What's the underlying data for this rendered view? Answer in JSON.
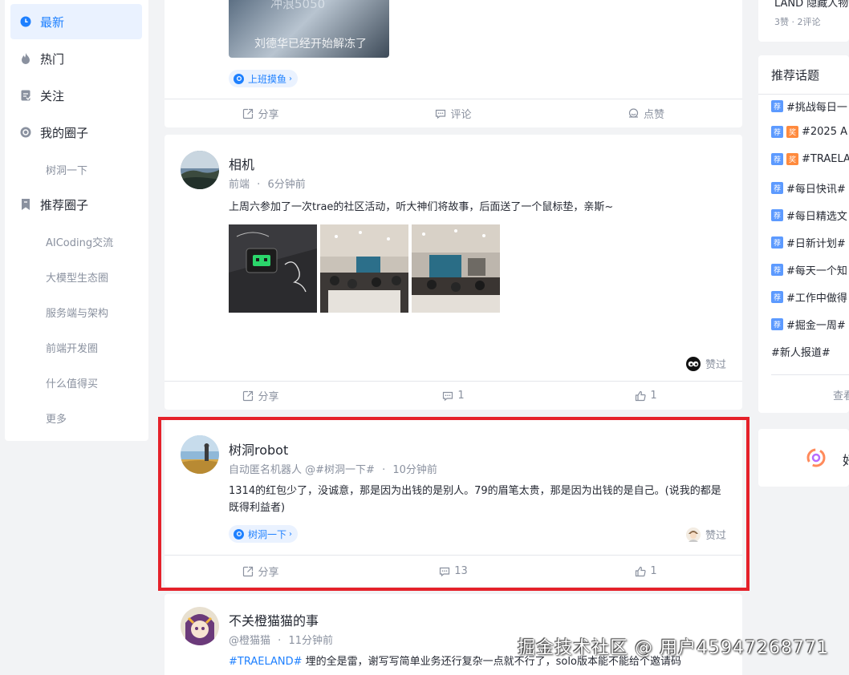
{
  "sidebar": {
    "items": [
      {
        "label": "最新",
        "icon": "clock-icon"
      },
      {
        "label": "热门",
        "icon": "flame-icon"
      },
      {
        "label": "关注",
        "icon": "follow-icon"
      },
      {
        "label": "我的圈子",
        "icon": "circle-icon"
      },
      {
        "label": "树洞一下"
      },
      {
        "label": "推荐圈子",
        "icon": "bookmark-icon"
      },
      {
        "label": "AICoding交流"
      },
      {
        "label": "大模型生态圈"
      },
      {
        "label": "服务端与架构"
      },
      {
        "label": "前端开发圈"
      },
      {
        "label": "什么值得买"
      },
      {
        "label": "更多"
      }
    ],
    "active_color": "#1e80ff"
  },
  "posts": [
    {
      "image_caption": "刘德华已经开始解冻了",
      "image_top_text": "冲浪5050",
      "tag": "上班摸鱼",
      "actions": {
        "share": "分享",
        "comment": "评论",
        "like": "点赞"
      }
    },
    {
      "author": "相机",
      "circle": "前端",
      "separator": "·",
      "time": "6分钟前",
      "text": "上周六参加了一次trae的社区活动，听大神们将故事，后面送了一个鼠标垫，亲斯~",
      "zan": "赞过",
      "actions": {
        "share": "分享",
        "comment": "1",
        "like": "1"
      }
    },
    {
      "author": "树洞robot",
      "meta": "自动匿名机器人 @#树洞一下#",
      "separator": "·",
      "time": "10分钟前",
      "text": "1314的红包少了，没诚意，那是因为出钱的是别人。79的眉笔太贵，那是因为出钱的是自己。(说我的都是既得利益者)",
      "tag": "树洞一下",
      "zan": "赞过",
      "actions": {
        "share": "分享",
        "comment": "13",
        "like": "1"
      }
    },
    {
      "author": "不关橙猫猫的事",
      "meta": "@橙猫猫",
      "separator": "·",
      "time": "11分钟前",
      "hashtag": "#TRAELAND#",
      "text": " 埋的全是雷，谢写写简单业务还行复杂一点就不行了，solo版本能不能给个邀请码"
    }
  ],
  "right": {
    "top_line": "LAND 隐藏人物",
    "top_stats": "3赞 · 2评论",
    "topics_title": "推荐话题",
    "topics": [
      {
        "badges": [
          "荐"
        ],
        "text": "#挑战每日一"
      },
      {
        "badges": [
          "荐",
          "奖"
        ],
        "text": "#2025 A"
      },
      {
        "badges": [
          "荐",
          "奖"
        ],
        "text": "#TRAELA"
      },
      {
        "badges": [
          "荐"
        ],
        "text": "#每日快讯#"
      },
      {
        "badges": [
          "荐"
        ],
        "text": "#每日精选文"
      },
      {
        "badges": [
          "荐"
        ],
        "text": "#日新计划#"
      },
      {
        "badges": [
          "荐"
        ],
        "text": "#每天一个知"
      },
      {
        "badges": [
          "荐"
        ],
        "text": "#工作中做得"
      },
      {
        "badges": [
          "荐"
        ],
        "text": "#掘金一周#"
      },
      {
        "badges": [],
        "text": "#新人报道#"
      }
    ],
    "more": "查看",
    "box_text": "好"
  },
  "watermark": "掘金技术社区 @ 用户45947268771"
}
